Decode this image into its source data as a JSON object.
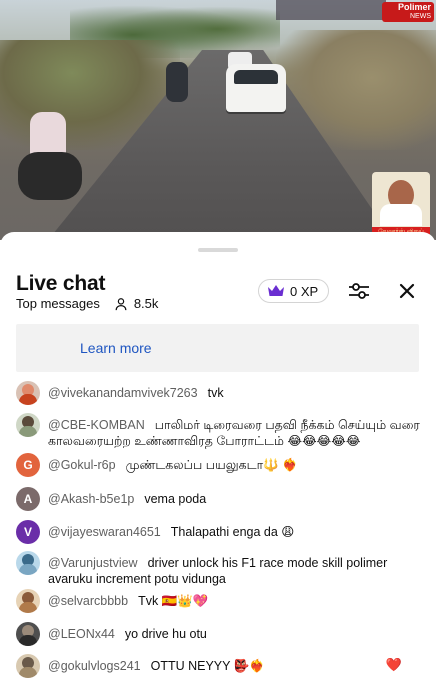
{
  "video": {
    "channel_logo": "Polimer",
    "channel_logo_sub": "NEWS",
    "promo_caption": "வேலூர்ஸ் விஜய்",
    "colors": {
      "logo_bg": "#c71a1a",
      "promo_caption_bg": "#d71f1f"
    }
  },
  "header": {
    "title": "Live chat",
    "mode": "Top messages",
    "viewer_icon": "person-icon",
    "viewers": "8.5k",
    "xp_icon": "crown-icon",
    "xp": "0 XP",
    "filter_icon": "sliders-icon",
    "close_icon": "close-icon"
  },
  "banner": {
    "link": "Learn more",
    "link_color": "#1f56c1"
  },
  "messages": [
    {
      "author": "@vivekanandamvivek7263",
      "text": "tvk",
      "avatar": {
        "type": "photo",
        "color": "#d9c2b5"
      }
    },
    {
      "author": "@CBE-KOMBAN",
      "text": "பாலிமர் டிரைவரை பதவி நீக்கம் செய்யும் வரை காலவரையற்ற உண்ணாவிரத போராட்டம் 😂😂😂😂😂",
      "avatar": {
        "type": "photo",
        "color": "#cfd7c6"
      }
    },
    {
      "author": "@Gokul-r6p",
      "text": "முண்டகலப்ப பயலுகடா🔱 ❤️‍🔥",
      "avatar": {
        "type": "letter",
        "letter": "G",
        "color": "#e2643d"
      }
    },
    {
      "author": "@Akash-b5e1p",
      "text": "vema poda",
      "avatar": {
        "type": "letter",
        "letter": "A",
        "color": "#7b6a6a"
      }
    },
    {
      "author": "@vijayeswaran4651",
      "text": "Thalapathi enga da 😩",
      "avatar": {
        "type": "letter",
        "letter": "V",
        "color": "#6a2ea8"
      }
    },
    {
      "author": "@Varunjustview",
      "text": "driver unlock his F1 race mode skill polimer avaruku increment potu vidunga",
      "avatar": {
        "type": "photo",
        "color": "#b9d8ea"
      }
    },
    {
      "author": "@selvarcbbbb",
      "text": "Tvk 🇪🇸👑💖",
      "avatar": {
        "type": "photo",
        "color": "#e7d3b6"
      }
    },
    {
      "author": "@LEONx44",
      "text": "yo drive hu otu",
      "avatar": {
        "type": "photo",
        "color": "#4f4f4f"
      }
    },
    {
      "author": "@gokulvlogs241",
      "text": "OTTU NEYYY 👺❤️‍🔥",
      "trailing": "❤️",
      "avatar": {
        "type": "photo",
        "color": "#d8c9b0"
      }
    }
  ]
}
